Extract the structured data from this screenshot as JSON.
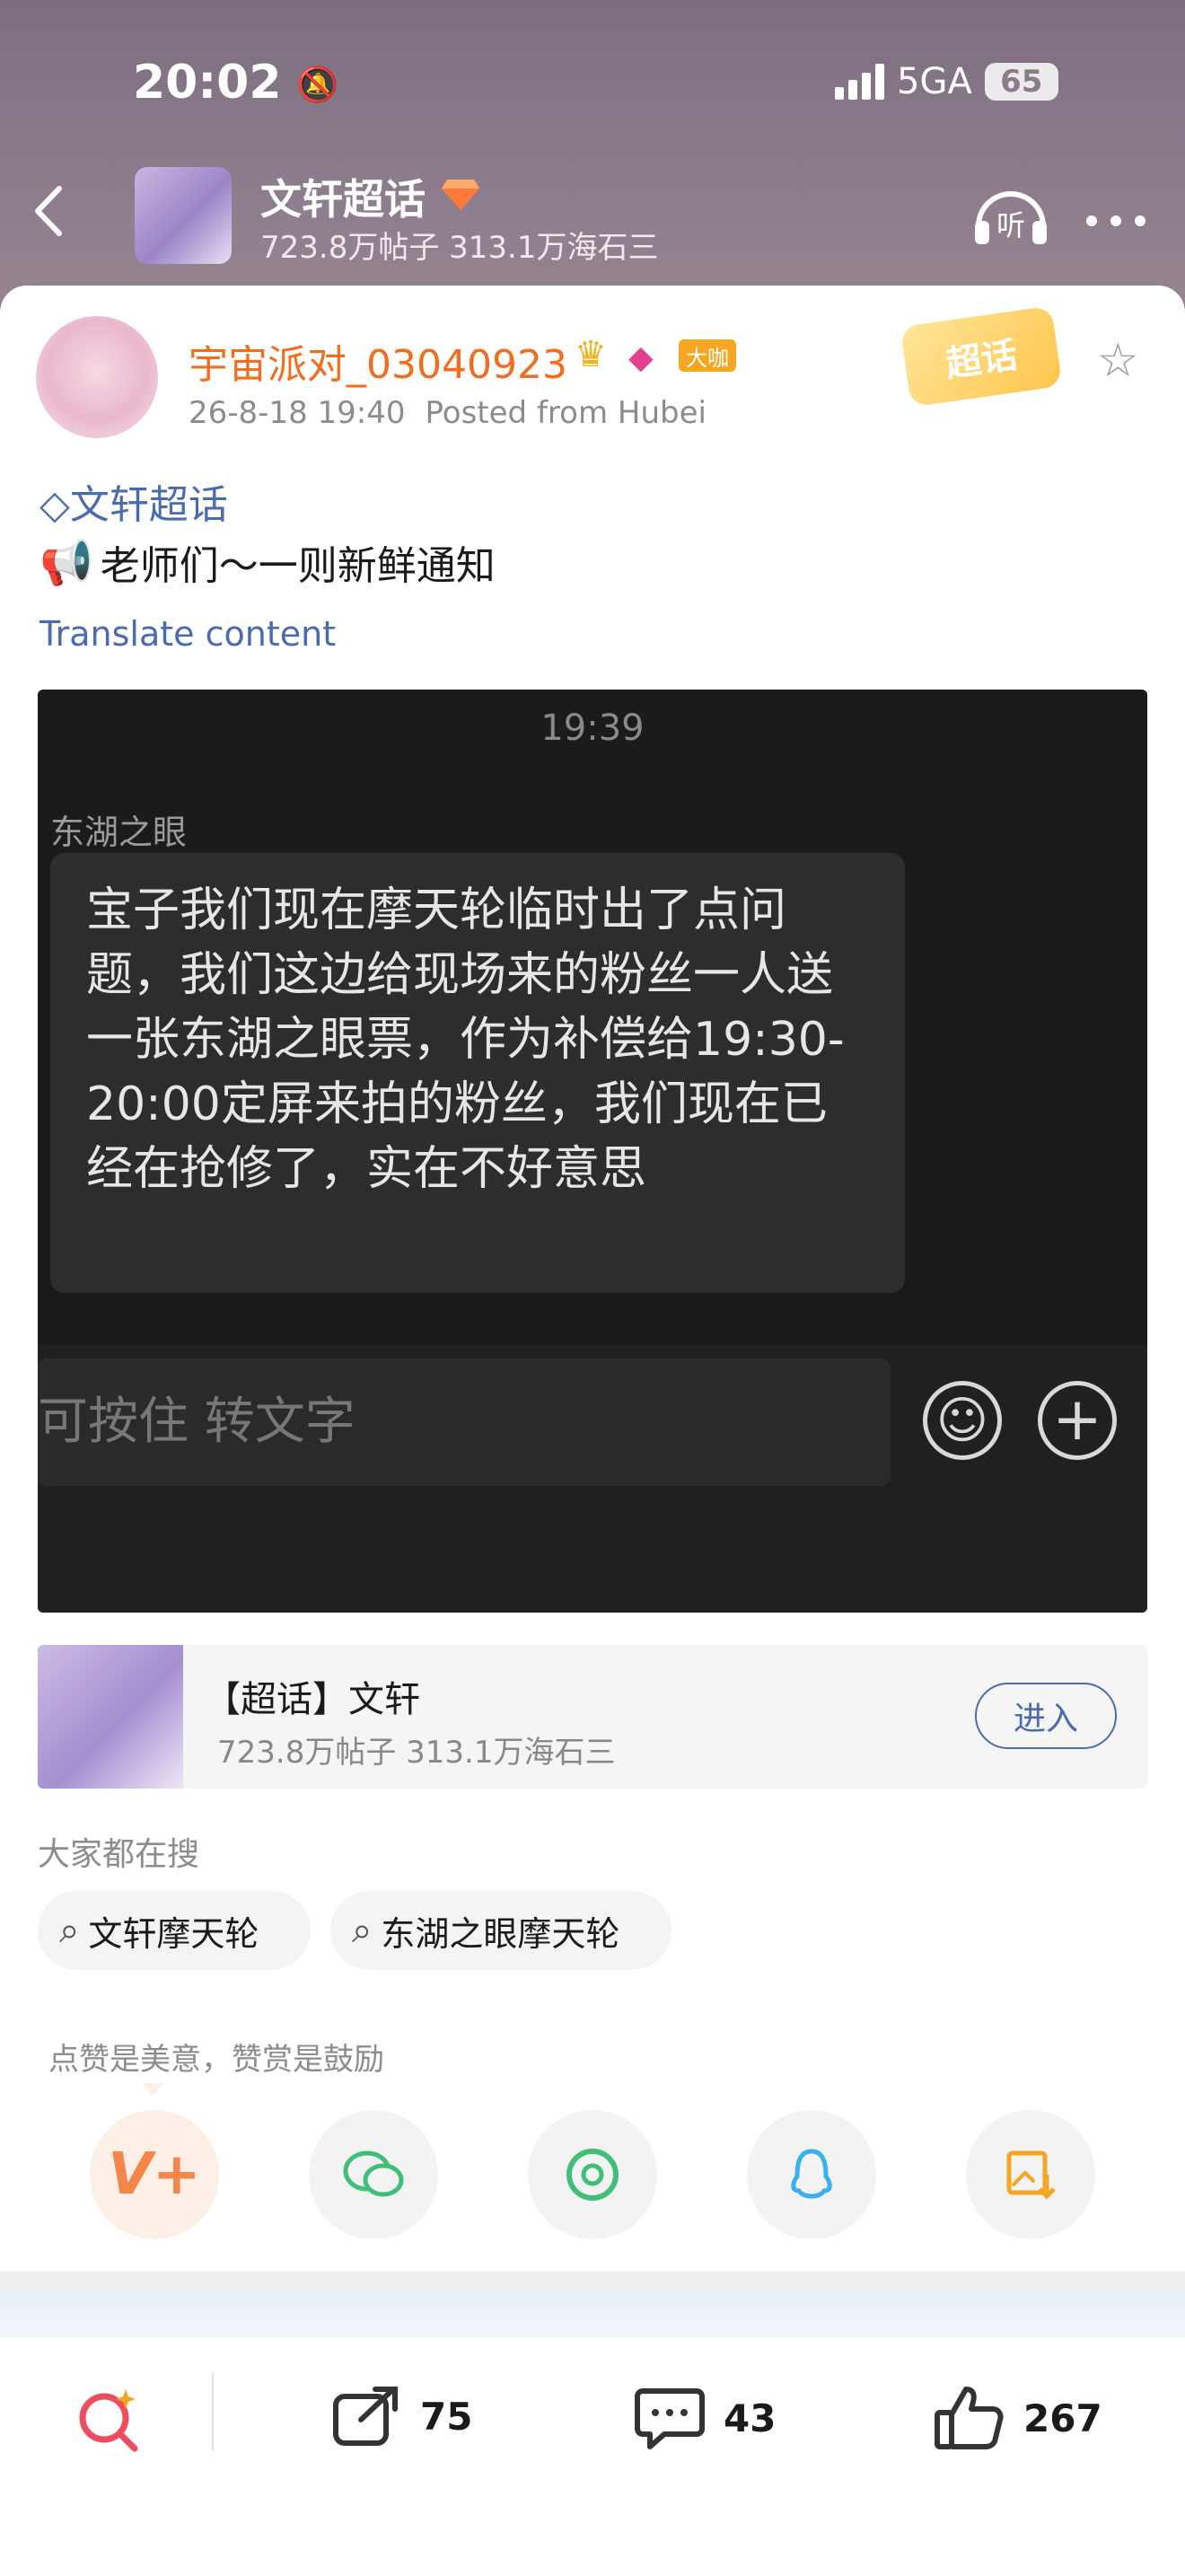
{
  "status_bar": {
    "time": "20:02",
    "network": "5GA",
    "battery": "65"
  },
  "header": {
    "back_icon": "chevron-left-icon",
    "topic_name": "文轩超话",
    "topic_stats": "723.8万帖子 313.1万海石三",
    "listen_label": "听",
    "more_icon": "more-dots-icon"
  },
  "post": {
    "username": "宇宙派对_03040923",
    "vip_badge": "大咖",
    "timestamp": "26-8-18 19:40",
    "location": "Posted from Hubei",
    "tag_label": "超话",
    "topic_link": "文轩超话",
    "text": "老师们～一则新鲜通知",
    "translate": "Translate content",
    "image": {
      "time": "19:39",
      "sender": "东湖之眼",
      "message": "宝子我们现在摩天轮临时出了点问题，我们这边给现场来的粉丝一人送一张东湖之眼票，作为补偿给19:30-20:00定屏来拍的粉丝，我们现在已经在抢修了，实在不好意思",
      "input_placeholder": "可按住 转文字"
    }
  },
  "supertopic_card": {
    "title": "【超话】文轩",
    "stats": "723.8万帖子 313.1万海石三",
    "enter": "进入"
  },
  "searches": {
    "heading": "大家都在搜",
    "items": [
      "文轩摩天轮",
      "东湖之眼摩天轮"
    ]
  },
  "reward": {
    "tip": "点赞是美意，赞赏是鼓励",
    "share_targets": [
      "reward-v-icon",
      "wechat-icon",
      "moments-icon",
      "qq-icon",
      "save-image-icon"
    ]
  },
  "bottom_bar": {
    "share_count": "75",
    "comment_count": "43",
    "like_count": "267"
  },
  "colors": {
    "username": "#f26d1e",
    "link": "#4a6bb0",
    "header_bg": "#8c7b8a"
  }
}
